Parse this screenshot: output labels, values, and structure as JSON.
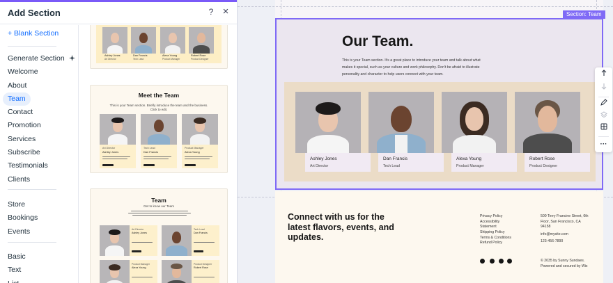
{
  "panel": {
    "title": "Add Section",
    "help_icon": "?",
    "close_icon": "×"
  },
  "nav": {
    "blank_section": "+ Blank Section",
    "generate_section": "Generate Section",
    "items_a": [
      "Welcome",
      "About",
      "Team",
      "Contact",
      "Promotion",
      "Services",
      "Subscribe",
      "Testimonials",
      "Clients"
    ],
    "active_item": "Team",
    "items_b": [
      "Store",
      "Bookings",
      "Events"
    ],
    "items_c": [
      "Basic",
      "Text",
      "List"
    ]
  },
  "thumbnails": {
    "t1": {
      "members": [
        {
          "name": "Ashley Jones",
          "role": "Art Director"
        },
        {
          "name": "Dan Francis",
          "role": "Tech Lead"
        },
        {
          "name": "Alexa Young",
          "role": "Product Manager"
        },
        {
          "name": "Robert Rose",
          "role": "Product Designer"
        }
      ]
    },
    "t2": {
      "title": "Meet the Team",
      "subtitle_1": "This is your Team section. Briefly introduce the team and the business.",
      "subtitle_2": "Click to edit.",
      "members": [
        {
          "role": "Art Director",
          "name": "Ashley Jones"
        },
        {
          "role": "Tech Lead",
          "name": "Dan Francis"
        },
        {
          "role": "Product Manager",
          "name": "Alexa Young"
        }
      ]
    },
    "t3": {
      "title": "Team",
      "subtitle": "Get to know our Team",
      "members": [
        {
          "role": "Art Director",
          "name": "Ashley Jones"
        },
        {
          "role": "Tech Lead",
          "name": "Dan Francis"
        },
        {
          "role": "Product Manager",
          "name": "Alexa Young"
        },
        {
          "role": "Product Designer",
          "name": "Robert Rose"
        }
      ]
    }
  },
  "canvas": {
    "section_tag": "Section: Team",
    "team_title": "Our Team.",
    "team_desc": "This is your Team section. It's a great place to introduce your team and talk about what makes it special, such as your culture and work philosophy. Don't be afraid to illustrate personality and character to help users connect with your team.",
    "members": [
      {
        "name": "Ashley Jones",
        "role": "Art Director"
      },
      {
        "name": "Dan Francis",
        "role": "Tech Lead"
      },
      {
        "name": "Alexa Young",
        "role": "Product Manager"
      },
      {
        "name": "Robert Rose",
        "role": "Product Designer"
      }
    ],
    "footer": {
      "headline": "Connect with us for the latest flavors, events, and updates.",
      "links": [
        "Privacy Policy",
        "Accessibility",
        "Statement",
        "Shipping Policy",
        "Terms & Conditions",
        "Refund Policy"
      ],
      "address_1": "500 Terry Francine Street, 6th",
      "address_2": "Floor, San Francisco, CA",
      "address_3": "94158",
      "email": "info@mysite.com",
      "phone": "123-456-7890",
      "copyright_1": "© 2035 by Sunny Sundaes.",
      "copyright_2": "Powered and secured by Wix"
    }
  },
  "toolbar": {
    "icons": [
      "move-up-icon",
      "move-down-icon",
      "design-icon",
      "layers-icon",
      "layout-icon",
      "more-icon"
    ]
  },
  "colors": {
    "accent": "#116dff",
    "selection": "#7f6af6",
    "team_bg": "#ebe6ef",
    "team_band": "#ebdcc7",
    "footer_bg": "#fdf8ef"
  }
}
